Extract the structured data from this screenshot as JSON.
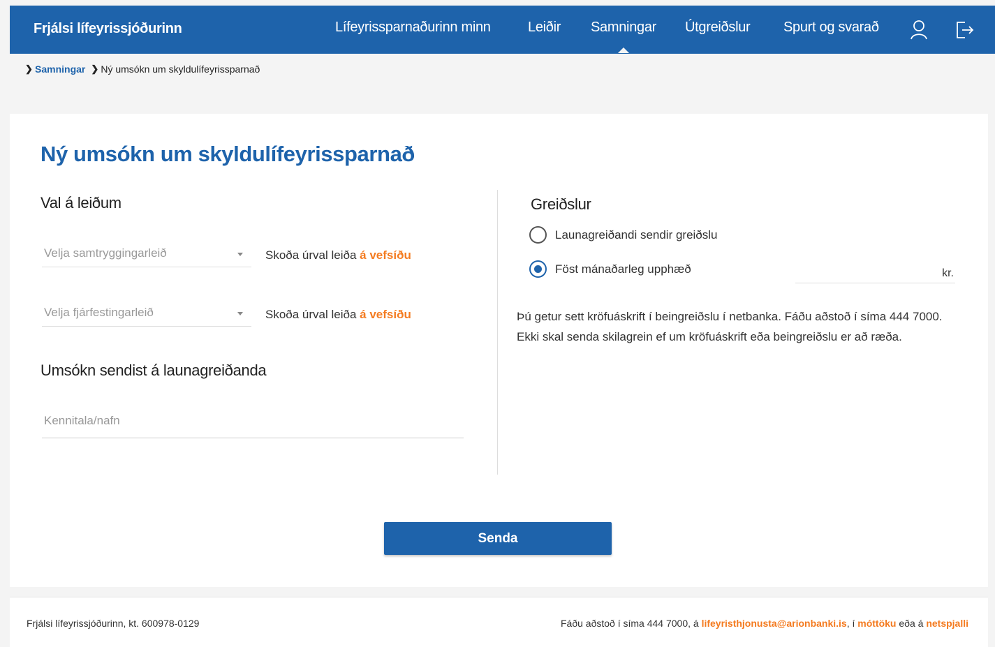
{
  "header": {
    "brand": "Frjálsi lífeyrissjóðurinn",
    "nav": [
      {
        "label": "Lífeyrissparnaðurinn minn",
        "active": false
      },
      {
        "label": "Leiðir",
        "active": false
      },
      {
        "label": "Samningar",
        "active": true
      },
      {
        "label": "Útgreiðslur",
        "active": false
      },
      {
        "label": "Spurt og svarað",
        "active": false
      }
    ],
    "icons": [
      "user-icon",
      "logout-icon"
    ]
  },
  "breadcrumb": {
    "link": "Samningar",
    "current": "Ný umsókn um skyldulífeyrissparnað"
  },
  "form": {
    "title": "Ný umsókn um skyldulífeyrissparnað",
    "left": {
      "section_title": "Val á leiðum",
      "select_1": {
        "placeholder": "Velja samtryggingarleið",
        "note": "Skoða úrval leiða ",
        "link": "á vefsíðu"
      },
      "select_2": {
        "placeholder": "Velja fjárfestingarleið",
        "note": "Skoða úrval leiða ",
        "link": "á vefsíðu"
      },
      "employer_title": "Umsókn sendist á launagreiðanda",
      "employer_placeholder": "Kennitala/nafn"
    },
    "right": {
      "section_title": "Greiðslur",
      "radio_1": {
        "label": "Launagreiðandi sendir greiðslu",
        "checked": false
      },
      "radio_2": {
        "label": "Föst mánaðarleg upphæð",
        "checked": true
      },
      "amount_value": "",
      "amount_unit": "kr.",
      "info": "Þú getur sett kröfuáskrift í beingreiðslu í netbanka. Fáðu aðstoð í síma 444 7000. Ekki skal senda skilagrein ef um kröfuáskrift eða beingreiðslu er að ræða."
    },
    "submit_label": "Senda"
  },
  "footer": {
    "left": "Frjálsi lífeyrissjóðurinn, kt. 600978-0129",
    "right_prefix": "Fáðu aðstoð í síma 444 7000, á ",
    "email": "lifeyristhjonusta@arionbanki.is",
    "sep1": ", í ",
    "reception": "móttöku",
    "sep2": " eða á ",
    "chat": "netspjalli"
  },
  "colors": {
    "primary": "#1e63ab",
    "accent": "#f47b20",
    "background": "#f4f4f4"
  }
}
